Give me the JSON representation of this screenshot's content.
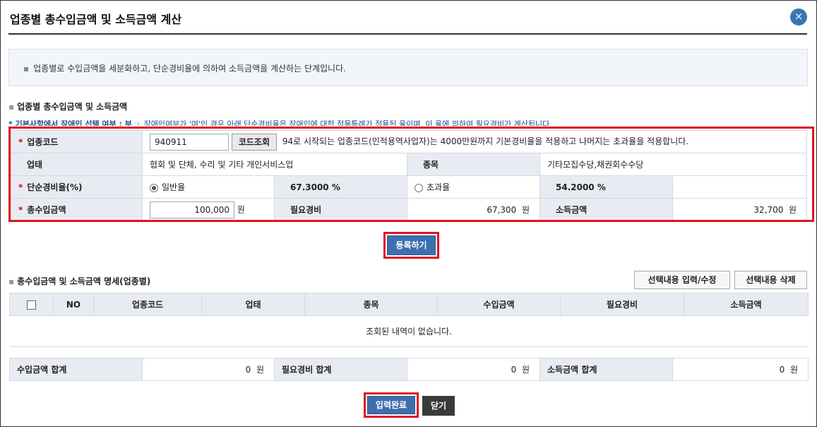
{
  "window": {
    "title": "업종별 총수입금액 및 소득금액 계산",
    "close_label": "×"
  },
  "info": {
    "bullet": "▪",
    "text": "업종별로 수입금액을 세분화하고, 단순경비율에 의하여 소득금액을 계산하는 단계입니다."
  },
  "section1": {
    "title": "업종별 총수입금액 및 소득금액",
    "notice_prefix": "* 기본사항에서 장애인 선택 여부 : 부",
    "notice_text": "☞ 장애인여부가 '여'인 경우 아래 단순경비율은 장애인에 대한 적용특례가 적용된 율이며, 이 율에 의하여 필요경비가 계산됩니다."
  },
  "form": {
    "required_mark": "*",
    "industry_code_label": "업종코드",
    "industry_code_value": "940911",
    "code_lookup_label": "코드조회",
    "code_note": "94로 시작되는 업종코드(인적용역사업자)는 4000만원까지 기본경비율을 적용하고 나머지는 초과율을 적용합니다.",
    "business_type_label": "업태",
    "business_type_value": "협회 및 단체, 수리 및 기타 개인서비스업",
    "item_label": "종목",
    "item_value": "기타모집수당,채권회수수당",
    "simple_rate_label": "단순경비율(%)",
    "general_rate_label": "일반율",
    "general_rate_value": "67.3000 %",
    "excess_rate_label": "초과율",
    "excess_rate_value": "54.2000 %",
    "general_rate_selected": true,
    "total_income_label": "총수입금액",
    "total_income_value": "100,000",
    "won": "원",
    "expense_label": "필요경비",
    "expense_value": "67,300",
    "income_label": "소득금액",
    "income_value": "32,700"
  },
  "register_button": "등록하기",
  "section2": {
    "title": "총수입금액 및 소득금액 명세(업종별)",
    "edit_button": "선택내용 입력/수정",
    "delete_button": "선택내용 삭제"
  },
  "list": {
    "columns": [
      "NO",
      "업종코드",
      "업태",
      "종목",
      "수입금액",
      "필요경비",
      "소득금액"
    ],
    "empty_message": "조회된 내역이 없습니다."
  },
  "summary": {
    "income_total_label": "수입금액 합계",
    "income_total_value": "0",
    "expense_total_label": "필요경비 합계",
    "expense_total_value": "0",
    "net_total_label": "소득금액 합계",
    "net_total_value": "0",
    "won": "원"
  },
  "footer": {
    "complete_button": "입력완료",
    "close_button": "닫기"
  },
  "colors": {
    "highlight": "#e0141e",
    "primary_button": "#3d6fb0",
    "header_bg": "#e8ebf2"
  }
}
